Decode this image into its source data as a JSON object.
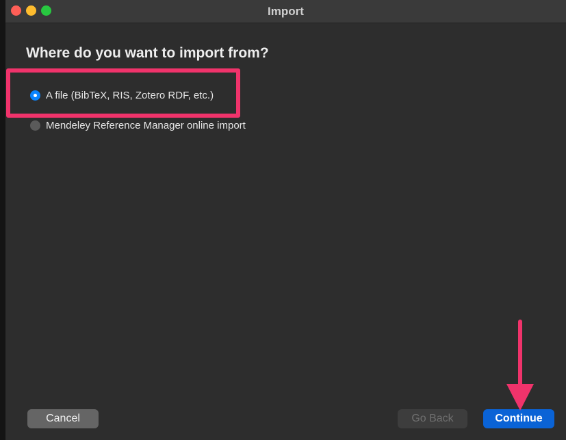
{
  "window": {
    "title": "Import"
  },
  "dialog": {
    "heading": "Where do you want to import from?",
    "options": [
      {
        "label": "A file (BibTeX, RIS, Zotero RDF, etc.)",
        "selected": true
      },
      {
        "label": "Mendeley Reference Manager online import",
        "selected": false
      }
    ]
  },
  "buttons": {
    "cancel": "Cancel",
    "go_back": "Go Back",
    "continue": "Continue"
  },
  "colors": {
    "annotation": "#f0336b",
    "accent": "#0a63d6",
    "radio_selected": "#0a84ff"
  },
  "icons": {
    "close": "close-icon",
    "minimize": "minimize-icon",
    "zoom": "zoom-icon",
    "arrow": "arrow-down-icon"
  }
}
